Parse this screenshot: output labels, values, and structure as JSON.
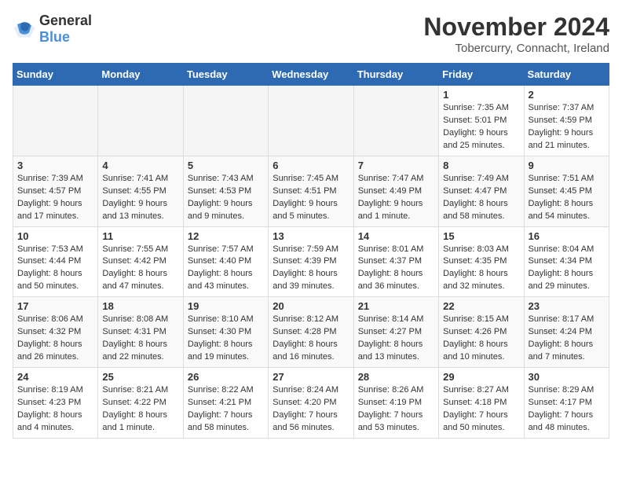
{
  "header": {
    "logo": {
      "general": "General",
      "blue": "Blue"
    },
    "title": "November 2024",
    "location": "Tobercurry, Connacht, Ireland"
  },
  "columns": [
    "Sunday",
    "Monday",
    "Tuesday",
    "Wednesday",
    "Thursday",
    "Friday",
    "Saturday"
  ],
  "weeks": [
    [
      {
        "day": "",
        "info": ""
      },
      {
        "day": "",
        "info": ""
      },
      {
        "day": "",
        "info": ""
      },
      {
        "day": "",
        "info": ""
      },
      {
        "day": "",
        "info": ""
      },
      {
        "day": "1",
        "info": "Sunrise: 7:35 AM\nSunset: 5:01 PM\nDaylight: 9 hours and 25 minutes."
      },
      {
        "day": "2",
        "info": "Sunrise: 7:37 AM\nSunset: 4:59 PM\nDaylight: 9 hours and 21 minutes."
      }
    ],
    [
      {
        "day": "3",
        "info": "Sunrise: 7:39 AM\nSunset: 4:57 PM\nDaylight: 9 hours and 17 minutes."
      },
      {
        "day": "4",
        "info": "Sunrise: 7:41 AM\nSunset: 4:55 PM\nDaylight: 9 hours and 13 minutes."
      },
      {
        "day": "5",
        "info": "Sunrise: 7:43 AM\nSunset: 4:53 PM\nDaylight: 9 hours and 9 minutes."
      },
      {
        "day": "6",
        "info": "Sunrise: 7:45 AM\nSunset: 4:51 PM\nDaylight: 9 hours and 5 minutes."
      },
      {
        "day": "7",
        "info": "Sunrise: 7:47 AM\nSunset: 4:49 PM\nDaylight: 9 hours and 1 minute."
      },
      {
        "day": "8",
        "info": "Sunrise: 7:49 AM\nSunset: 4:47 PM\nDaylight: 8 hours and 58 minutes."
      },
      {
        "day": "9",
        "info": "Sunrise: 7:51 AM\nSunset: 4:45 PM\nDaylight: 8 hours and 54 minutes."
      }
    ],
    [
      {
        "day": "10",
        "info": "Sunrise: 7:53 AM\nSunset: 4:44 PM\nDaylight: 8 hours and 50 minutes."
      },
      {
        "day": "11",
        "info": "Sunrise: 7:55 AM\nSunset: 4:42 PM\nDaylight: 8 hours and 47 minutes."
      },
      {
        "day": "12",
        "info": "Sunrise: 7:57 AM\nSunset: 4:40 PM\nDaylight: 8 hours and 43 minutes."
      },
      {
        "day": "13",
        "info": "Sunrise: 7:59 AM\nSunset: 4:39 PM\nDaylight: 8 hours and 39 minutes."
      },
      {
        "day": "14",
        "info": "Sunrise: 8:01 AM\nSunset: 4:37 PM\nDaylight: 8 hours and 36 minutes."
      },
      {
        "day": "15",
        "info": "Sunrise: 8:03 AM\nSunset: 4:35 PM\nDaylight: 8 hours and 32 minutes."
      },
      {
        "day": "16",
        "info": "Sunrise: 8:04 AM\nSunset: 4:34 PM\nDaylight: 8 hours and 29 minutes."
      }
    ],
    [
      {
        "day": "17",
        "info": "Sunrise: 8:06 AM\nSunset: 4:32 PM\nDaylight: 8 hours and 26 minutes."
      },
      {
        "day": "18",
        "info": "Sunrise: 8:08 AM\nSunset: 4:31 PM\nDaylight: 8 hours and 22 minutes."
      },
      {
        "day": "19",
        "info": "Sunrise: 8:10 AM\nSunset: 4:30 PM\nDaylight: 8 hours and 19 minutes."
      },
      {
        "day": "20",
        "info": "Sunrise: 8:12 AM\nSunset: 4:28 PM\nDaylight: 8 hours and 16 minutes."
      },
      {
        "day": "21",
        "info": "Sunrise: 8:14 AM\nSunset: 4:27 PM\nDaylight: 8 hours and 13 minutes."
      },
      {
        "day": "22",
        "info": "Sunrise: 8:15 AM\nSunset: 4:26 PM\nDaylight: 8 hours and 10 minutes."
      },
      {
        "day": "23",
        "info": "Sunrise: 8:17 AM\nSunset: 4:24 PM\nDaylight: 8 hours and 7 minutes."
      }
    ],
    [
      {
        "day": "24",
        "info": "Sunrise: 8:19 AM\nSunset: 4:23 PM\nDaylight: 8 hours and 4 minutes."
      },
      {
        "day": "25",
        "info": "Sunrise: 8:21 AM\nSunset: 4:22 PM\nDaylight: 8 hours and 1 minute."
      },
      {
        "day": "26",
        "info": "Sunrise: 8:22 AM\nSunset: 4:21 PM\nDaylight: 7 hours and 58 minutes."
      },
      {
        "day": "27",
        "info": "Sunrise: 8:24 AM\nSunset: 4:20 PM\nDaylight: 7 hours and 56 minutes."
      },
      {
        "day": "28",
        "info": "Sunrise: 8:26 AM\nSunset: 4:19 PM\nDaylight: 7 hours and 53 minutes."
      },
      {
        "day": "29",
        "info": "Sunrise: 8:27 AM\nSunset: 4:18 PM\nDaylight: 7 hours and 50 minutes."
      },
      {
        "day": "30",
        "info": "Sunrise: 8:29 AM\nSunset: 4:17 PM\nDaylight: 7 hours and 48 minutes."
      }
    ]
  ]
}
